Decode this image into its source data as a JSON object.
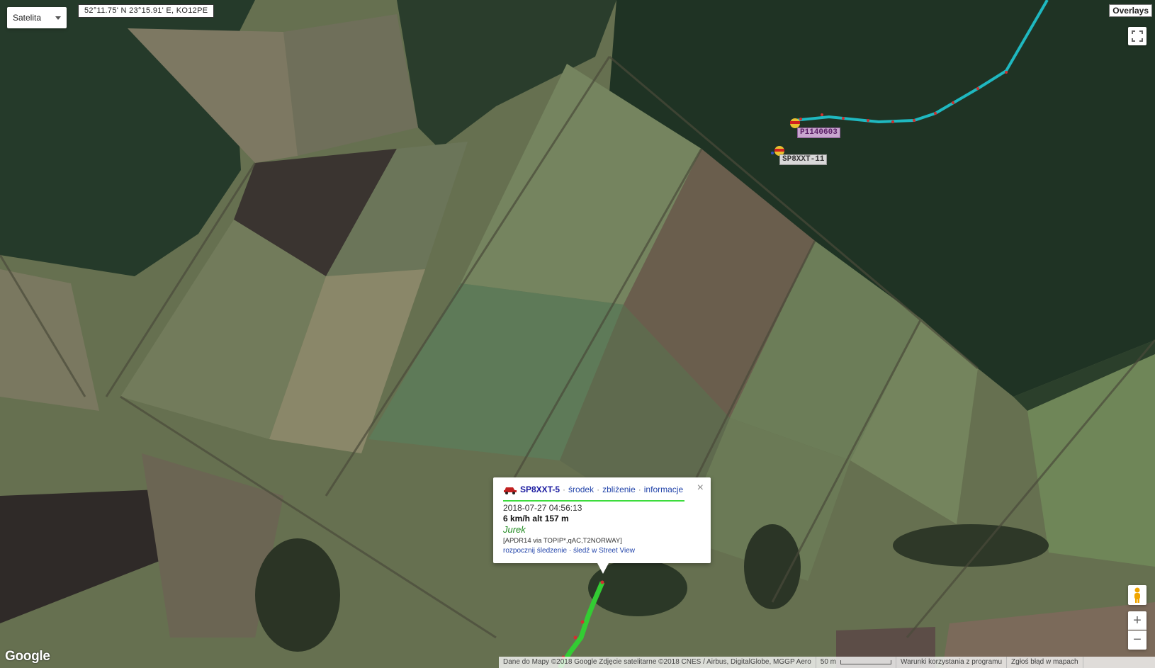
{
  "map_type": {
    "selected": "Satelita"
  },
  "coordinates": "52°11.75' N 23°15.91' E, KO12PE",
  "overlays_label": "Overlays",
  "stations": {
    "p1140603": "P1140603",
    "sp8xxt11": "SP8XXT-11"
  },
  "popup": {
    "callsign": "SP8XXT-5",
    "link_center": "środek",
    "link_zoom": "zbliżenie",
    "link_info": "informacje",
    "time": "2018-07-27 04:56:13",
    "speed_alt": "6 km/h alt 157 m",
    "comment": "Jurek",
    "path": "[APDR14 via TOPIP*,qAC,T2NORWAY]",
    "link_track": "rozpocznij śledzenie",
    "link_streetview": "śledź w Street View",
    "close_symbol": "×"
  },
  "watermark": "Google",
  "attribution": {
    "data": "Dane do Mapy ©2018 Google Zdjęcie satelitarne ©2018 CNES / Airbus, DigitalGlobe, MGGP Aero",
    "scale": "50 m",
    "terms": "Warunki korzystania z programu",
    "report": "Zgłoś błąd w mapach"
  },
  "controls": {
    "zoom_in": "+",
    "zoom_out": "−"
  },
  "colors": {
    "track_cyan": "#1fb8c0",
    "track_green": "#33cc33",
    "forest": "#1f3324",
    "field": "#6f7a55"
  }
}
